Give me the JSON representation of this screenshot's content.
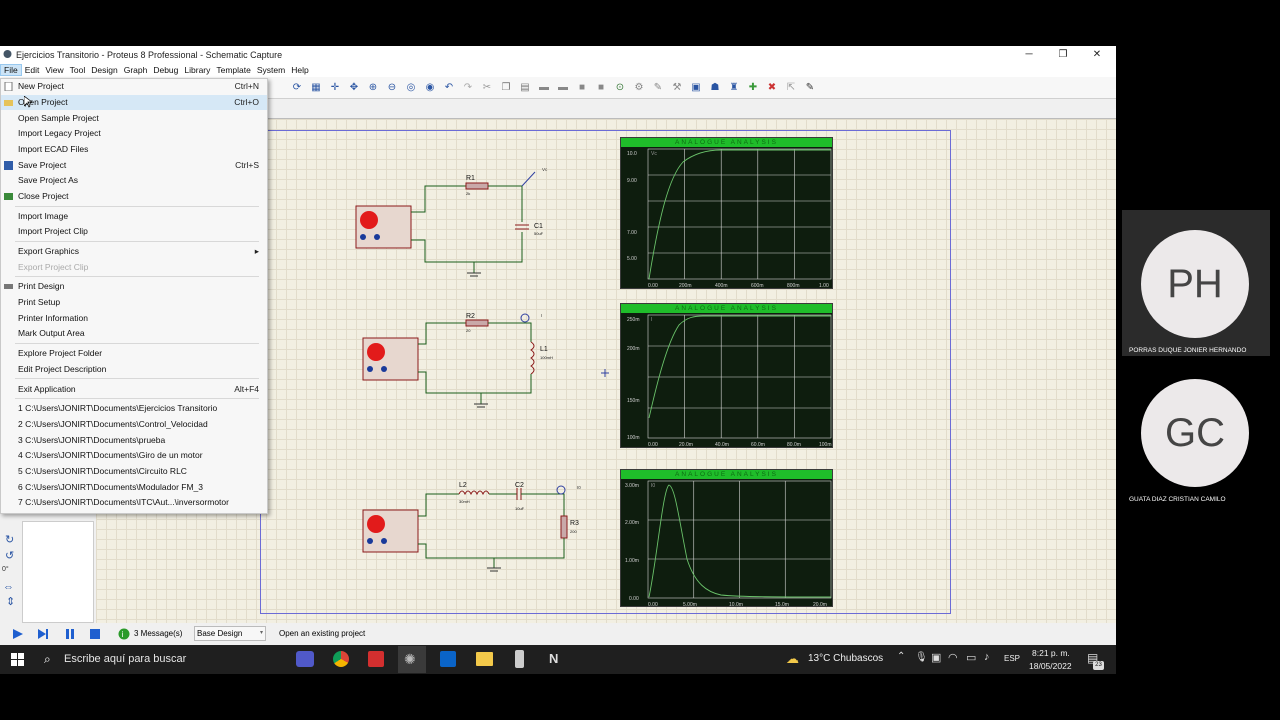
{
  "window": {
    "title": "Ejercicios Transitorio - Proteus 8 Professional - Schematic Capture",
    "min": "─",
    "max": "❐",
    "close": "✕"
  },
  "menubar": [
    "File",
    "Edit",
    "View",
    "Tool",
    "Design",
    "Graph",
    "Debug",
    "Library",
    "Template",
    "System",
    "Help"
  ],
  "file_menu": {
    "items": [
      {
        "label": "New Project",
        "shortcut": "Ctrl+N"
      },
      {
        "label": "Open Project",
        "shortcut": "Ctrl+O"
      },
      {
        "label": "Open Sample Project",
        "shortcut": ""
      },
      {
        "label": "Import Legacy Project",
        "shortcut": ""
      },
      {
        "label": "Import ECAD Files",
        "shortcut": ""
      },
      {
        "label": "Save Project",
        "shortcut": "Ctrl+S"
      },
      {
        "label": "Save Project As",
        "shortcut": ""
      },
      {
        "label": "Close Project",
        "shortcut": ""
      },
      {
        "label": "Import Image",
        "shortcut": ""
      },
      {
        "label": "Import Project Clip",
        "shortcut": ""
      },
      {
        "label": "Export Graphics",
        "shortcut": ""
      },
      {
        "label": "Export Project Clip",
        "shortcut": ""
      },
      {
        "label": "Print Design",
        "shortcut": ""
      },
      {
        "label": "Print Setup",
        "shortcut": ""
      },
      {
        "label": "Printer Information",
        "shortcut": ""
      },
      {
        "label": "Mark Output Area",
        "shortcut": ""
      },
      {
        "label": "Explore Project Folder",
        "shortcut": ""
      },
      {
        "label": "Edit Project Description",
        "shortcut": ""
      },
      {
        "label": "Exit Application",
        "shortcut": "Alt+F4"
      }
    ],
    "recent": [
      "1 C:\\Users\\JONIRT\\Documents\\Ejercicios Transitorio",
      "2 C:\\Users\\JONIRT\\Documents\\Control_Velocidad",
      "3 C:\\Users\\JONIRT\\Documents\\prueba",
      "4 C:\\Users\\JONIRT\\Documents\\Giro de un motor",
      "5 C:\\Users\\JONIRT\\Documents\\Circuito RLC",
      "6 C:\\Users\\JONIRT\\Documents\\Modulador FM_3",
      "7 C:\\Users\\JONIRT\\Documents\\ITC\\Aut...\\inversormotor"
    ],
    "submenu_arrow": "▸"
  },
  "schematic": {
    "c1": {
      "r": "R1",
      "rv": "2k",
      "c": "C1",
      "cv": "50uF",
      "probe": "Vc"
    },
    "c2": {
      "r": "R2",
      "rv": "20",
      "l": "L1",
      "lv": "100mH",
      "probe": "I"
    },
    "c3": {
      "l": "L2",
      "lv": "30mH",
      "c": "C2",
      "cv": "10uF",
      "r": "R3",
      "rv": "200",
      "probe": "I0"
    }
  },
  "scopes": [
    {
      "title": "ANALOGUE ANALYSIS",
      "trace": "Vc",
      "y": [
        "10.0",
        "9.00",
        "7.00",
        "5.00"
      ],
      "x": [
        "0.00",
        "200m",
        "400m",
        "600m",
        "800m",
        "1.00"
      ]
    },
    {
      "title": "ANALOGUE ANALYSIS",
      "trace": "I",
      "y": [
        "250m",
        "200m",
        "150m",
        "100m"
      ],
      "x": [
        "0.00",
        "20.0m",
        "40.0m",
        "60.0m",
        "80.0m",
        "100m"
      ]
    },
    {
      "title": "ANALOGUE ANALYSIS",
      "trace": "I0",
      "y": [
        "3.00m",
        "2.00m",
        "1.00m",
        "0.00"
      ],
      "x": [
        "0.00",
        "5.00m",
        "10.0m",
        "15.0m",
        "20.0m"
      ]
    }
  ],
  "statusbar": {
    "messages": "3 Message(s)",
    "layer": "Base Design",
    "hint": "Open an existing project"
  },
  "left_panel_value": "0°",
  "taskbar": {
    "search": "Escribe aquí para buscar",
    "weather": "13°C  Chubascos",
    "lang": "ESP",
    "time": "8:21 p. m.",
    "date": "18/05/2022",
    "notif": "23"
  },
  "participants": [
    {
      "initials": "PH",
      "name": "PORRAS DUQUE JONIER HERNANDO"
    },
    {
      "initials": "GC",
      "name": "GUATA DIAZ CRISTIAN CAMILO"
    }
  ]
}
